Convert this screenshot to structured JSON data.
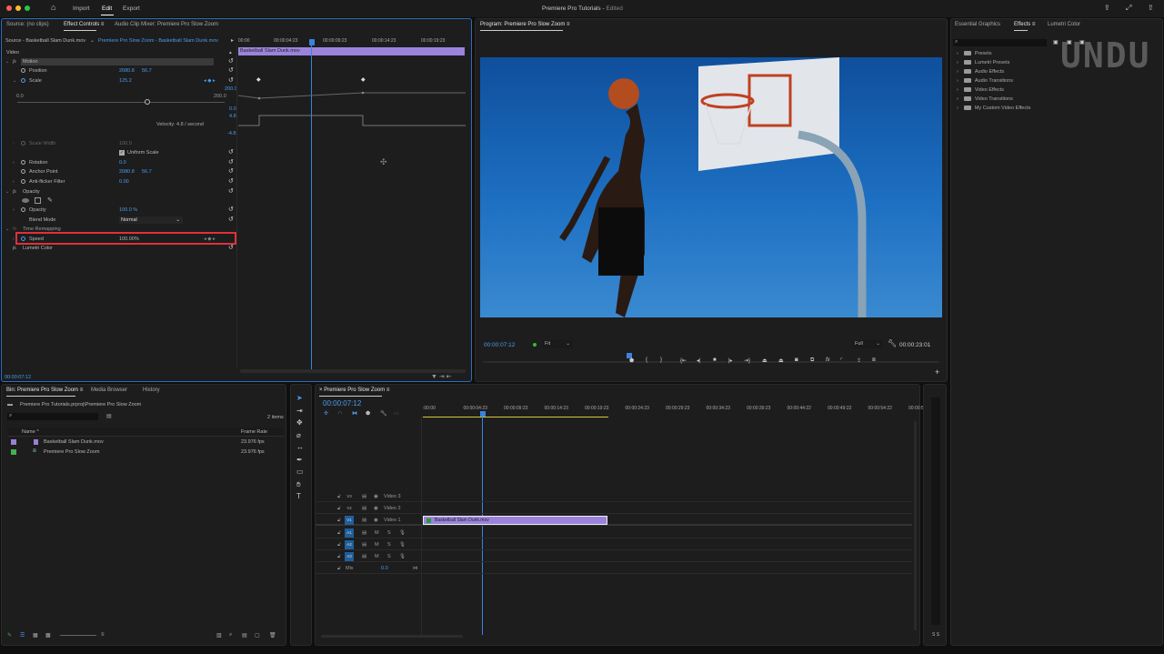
{
  "app": {
    "title": "Premiere Pro Tutorials",
    "status": "Edited",
    "nav": [
      "Import",
      "Edit",
      "Export"
    ]
  },
  "effect_controls": {
    "tabs": [
      "Source: (no clips)",
      "Effect Controls",
      "Audio Clip Mixer: Premiere Pro Slow Zoom"
    ],
    "source": "Source - Basketball Slam Dunk.mov",
    "sequence": "Premiere Pro Slow Zoom - Basketball Slam Dunk.mov",
    "ruler": [
      "00:00",
      "00:00:04:23",
      "00:00:09:23",
      "00:00:14:23",
      "00:00:19:23"
    ],
    "clip_name": "Basketball Slam Dunk.mov",
    "section": "Video",
    "motion": "Motion",
    "position": {
      "label": "Position",
      "x": "2080.8",
      "y": "56.7"
    },
    "scale": {
      "label": "Scale",
      "value": "125.2",
      "graph_max": "200.0",
      "slider_min": "0.0",
      "slider_max": "200.0",
      "graph_min": "0.0",
      "vel_max": "4.8",
      "velocity": "Velocity: 4.8 / second",
      "vel_min": "-4.8",
      "slider_fraction": 0.626
    },
    "scale_width": {
      "label": "Scale Width",
      "value": "100.0"
    },
    "uniform_scale": "Uniform Scale",
    "rotation": {
      "label": "Rotation",
      "value": "0.0"
    },
    "anchor": {
      "label": "Anchor Point",
      "x": "2080.8",
      "y": "56.7"
    },
    "antiflicker": {
      "label": "Anti-flicker Filter",
      "value": "0.00"
    },
    "opacity_section": "Opacity",
    "opacity": {
      "label": "Opacity",
      "value": "100.0 %"
    },
    "blend": {
      "label": "Blend Mode",
      "value": "Normal"
    },
    "time_remap": "Time Remapping",
    "speed": {
      "label": "Speed",
      "value": "100.00%"
    },
    "lumetri": "Lumetri Color",
    "timecode": "00:00:07:12"
  },
  "program": {
    "title": "Program: Premiere Pro Slow Zoom",
    "timecode": "00:00:07:12",
    "fit": "Fit",
    "quality": "Full",
    "duration": "00:00:23:01"
  },
  "effects_panel": {
    "tabs": [
      "Essential Graphics",
      "Effects",
      "Lumetri Color"
    ],
    "watermark": "UNDU",
    "items": [
      "Presets",
      "Lumetri Presets",
      "Audio Effects",
      "Audio Transitions",
      "Video Effects",
      "Video Transitions",
      "My Custom Video Effects"
    ]
  },
  "bin": {
    "tabs": [
      "Bin: Premiere Pro Slow Zoom",
      "Media Browser",
      "History"
    ],
    "path": "Premiere Pro Tutorials.prproj\\Premiere Pro Slow Zoom",
    "count": "2 items",
    "columns": [
      "Name",
      "Frame Rate"
    ],
    "items": [
      {
        "name": "Basketball Slam Dunk.mov",
        "fps": "23.976 fps",
        "color": "#9b7fd6"
      },
      {
        "name": "Premiere Pro Slow Zoom",
        "fps": "23.976 fps",
        "color": "#3fb34f"
      }
    ]
  },
  "timeline": {
    "title": "Premiere Pro Slow Zoom",
    "timecode": "00:00:07:12",
    "ruler": [
      ":00:00",
      "00:00:04:23",
      "00:00:09:23",
      "00:00:14:23",
      "00:00:19:23",
      "00:00:24:23",
      "00:00:29:23",
      "00:00:34:23",
      "00:00:39:23",
      "00:00:44:22",
      "00:00:49:22",
      "00:00:54:22",
      "00:00:59:"
    ],
    "video_tracks": [
      {
        "id": "V3",
        "name": "Video 3"
      },
      {
        "id": "V2",
        "name": "Video 2"
      },
      {
        "id": "V1",
        "name": "Video 1"
      }
    ],
    "audio_tracks": [
      {
        "id": "A1"
      },
      {
        "id": "A2"
      },
      {
        "id": "A3"
      }
    ],
    "mute": "M",
    "solo": "S",
    "mix": "Mix",
    "mix_value": "0.0",
    "clip": "Basketball Slam Dunk.mov"
  },
  "colors": {
    "accent": "#4b9cf0",
    "clip": "#9b83dc",
    "highlight": "#e0303c"
  }
}
